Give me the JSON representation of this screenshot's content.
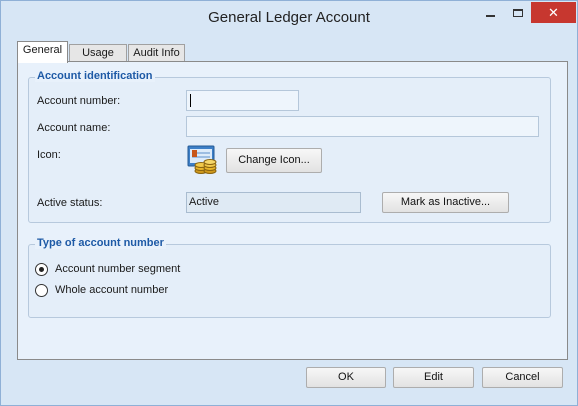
{
  "window": {
    "title": "General Ledger Account",
    "close_glyph": "✕"
  },
  "tabs": [
    {
      "label": "General",
      "active": true
    },
    {
      "label": "Usage",
      "active": false
    },
    {
      "label": "Audit Info",
      "active": false
    }
  ],
  "account_identification": {
    "title": "Account identification",
    "account_number_label": "Account number:",
    "account_number_value": "",
    "account_name_label": "Account name:",
    "account_name_value": "",
    "icon_label": "Icon:",
    "icon_name": "ledger-coins-icon",
    "change_icon_button": "Change Icon...",
    "active_status_label": "Active status:",
    "active_status_value": "Active",
    "mark_inactive_button": "Mark as Inactive..."
  },
  "type_of_account_number": {
    "title": "Type of account number",
    "options": [
      {
        "label": "Account number segment",
        "selected": true
      },
      {
        "label": "Whole account number",
        "selected": false
      }
    ]
  },
  "footer": {
    "ok": "OK",
    "edit": "Edit",
    "cancel": "Cancel"
  },
  "colors": {
    "accent": "#1e5aa6",
    "close_button": "#c7372f",
    "window_frame": "#d7e6f5"
  }
}
